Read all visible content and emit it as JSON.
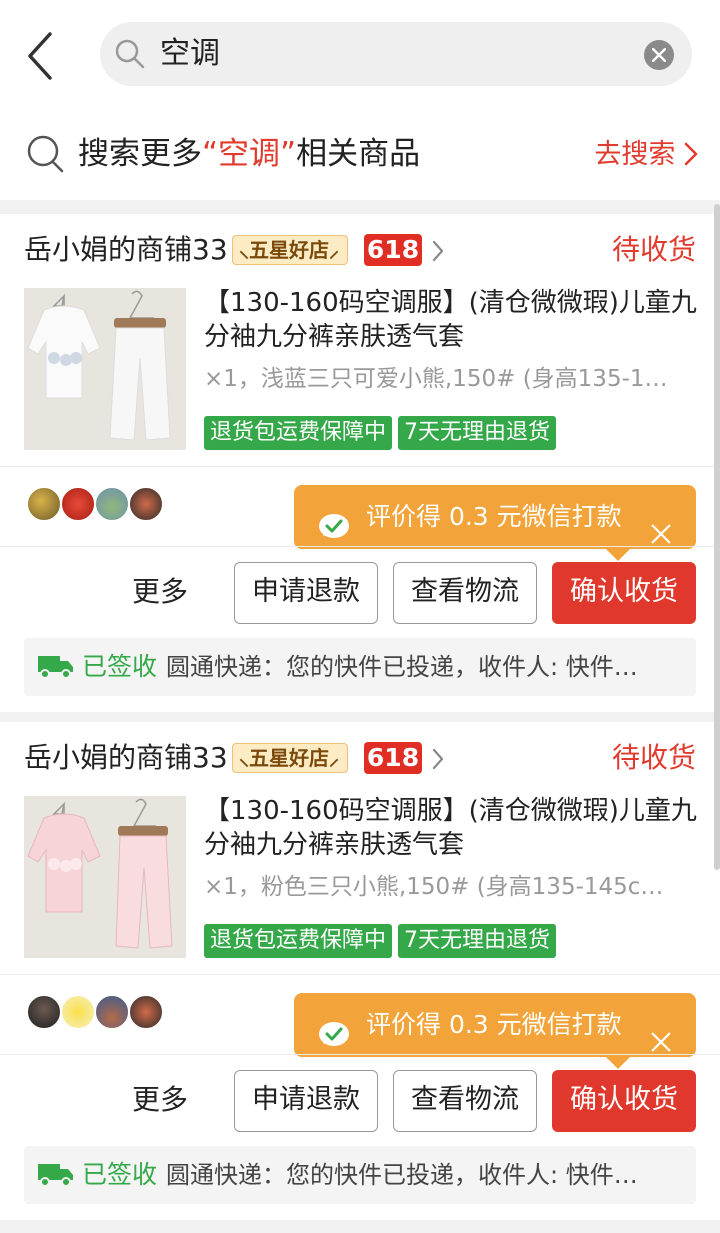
{
  "search": {
    "query": "空调"
  },
  "suggest": {
    "prefix": "搜索更多",
    "keyword": "“空调”",
    "suffix": "相关商品",
    "action": "去搜索"
  },
  "colors": {
    "accent": "#e13b2e",
    "green": "#35a849",
    "orange": "#f2a43a"
  },
  "orders": [
    {
      "shop_name": "岳小娟的商铺33",
      "badge_star": "五星好店",
      "badge_618": "618",
      "status": "待收货",
      "title": "【130-160码空调服】(清仓微微瑕)儿童九分袖九分裤亲肤透气套",
      "sku": "×1，浅蓝三只可爱小熊,150# (身高135-1…",
      "tags": [
        "退货包运费保障中",
        "7天无理由退货"
      ],
      "promo": "评价得 0.3 元微信打款",
      "more": "更多",
      "buttons": [
        "申请退款",
        "查看物流",
        "确认收货"
      ],
      "logistics_status": "已签收",
      "logistics_info": "圆通快递：您的快件已投递，收件人: 快件…",
      "product_color": "light-blue"
    },
    {
      "shop_name": "岳小娟的商铺33",
      "badge_star": "五星好店",
      "badge_618": "618",
      "status": "待收货",
      "title": "【130-160码空调服】(清仓微微瑕)儿童九分袖九分裤亲肤透气套",
      "sku": "×1，粉色三只小熊,150# (身高135-145c…",
      "tags": [
        "退货包运费保障中",
        "7天无理由退货"
      ],
      "promo": "评价得 0.3 元微信打款",
      "more": "更多",
      "buttons": [
        "申请退款",
        "查看物流",
        "确认收货"
      ],
      "logistics_status": "已签收",
      "logistics_info": "圆通快递：您的快件已投递，收件人: 快件…",
      "product_color": "pink"
    }
  ]
}
